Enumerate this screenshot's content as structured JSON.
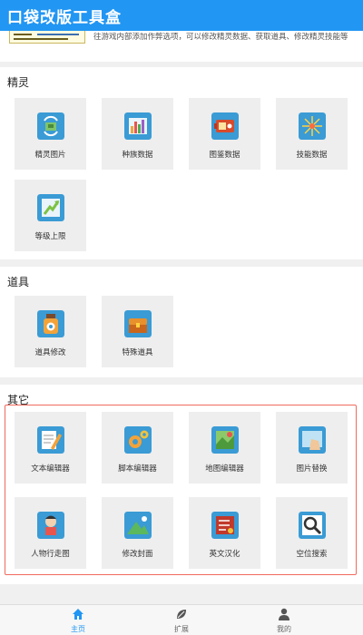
{
  "app": {
    "title": "口袋改版工具盒",
    "accent": "#2196f3"
  },
  "intro": {
    "thumbnail_icon": "game-screenshot-thumbnail",
    "description": "往游戏内部添加作弊选项，可以修改精灵数据、获取道具、修改精灵技能等"
  },
  "sections": {
    "sprite": {
      "title": "精灵",
      "items": [
        {
          "label": "精灵图片",
          "icon": "sprite-image-icon"
        },
        {
          "label": "种族数据",
          "icon": "bar-chart-icon"
        },
        {
          "label": "图鉴数据",
          "icon": "pokedex-icon"
        },
        {
          "label": "技能数据",
          "icon": "fireworks-icon"
        },
        {
          "label": "等级上限",
          "icon": "level-up-icon"
        }
      ]
    },
    "items": {
      "title": "道具",
      "items": [
        {
          "label": "道具修改",
          "icon": "potion-bottle-icon"
        },
        {
          "label": "特殊道具",
          "icon": "treasure-chest-icon"
        }
      ]
    },
    "other": {
      "title": "其它",
      "items": [
        {
          "label": "文本编辑器",
          "icon": "text-editor-icon"
        },
        {
          "label": "脚本编辑器",
          "icon": "gears-icon"
        },
        {
          "label": "地图编辑器",
          "icon": "map-icon"
        },
        {
          "label": "图片替换",
          "icon": "image-replace-icon"
        },
        {
          "label": "人物行走图",
          "icon": "character-sprite-icon"
        },
        {
          "label": "修改封面",
          "icon": "cover-landscape-icon"
        },
        {
          "label": "英文汉化",
          "icon": "translate-list-icon"
        },
        {
          "label": "空位搜索",
          "icon": "magnifier-icon"
        }
      ]
    }
  },
  "bottom_nav": [
    {
      "label": "主页",
      "icon": "home-icon",
      "active": true
    },
    {
      "label": "扩展",
      "icon": "leaf-icon",
      "active": false
    },
    {
      "label": "我的",
      "icon": "person-icon",
      "active": false
    }
  ]
}
